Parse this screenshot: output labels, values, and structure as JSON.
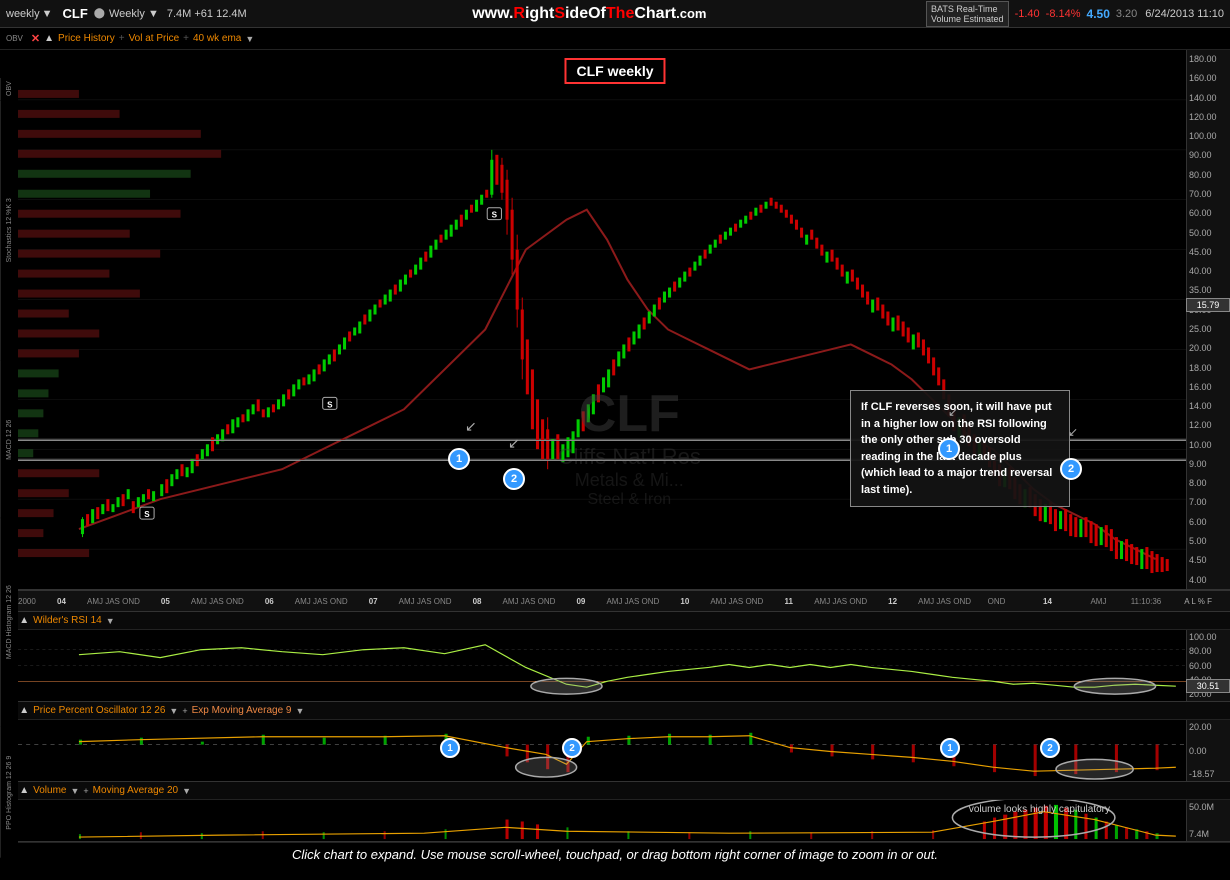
{
  "topbar": {
    "weekly_label": "weekly",
    "ticker": "CLF",
    "timeframe": "Weekly",
    "volume": "7.4M",
    "change_pts": "+61",
    "change_max": "12.4M",
    "website": "www.RightSideOfTheChart.com",
    "bats_label": "BATS Real-Time",
    "volume_est": "Volume Estimated",
    "price_change": "-1.40",
    "price_pct": "-8.14%",
    "price_val": "4.50",
    "price_low": "3.20",
    "datetime": "6/24/2013  11:10"
  },
  "indicators": {
    "price_history": "Price History",
    "vol_at_price": "Vol at Price",
    "ema_40": "40 wk ema"
  },
  "chart": {
    "title": "CLF weekly",
    "watermark": "CLF",
    "watermark_sub1": "Cliffs Nat'l Res",
    "watermark_sub2": "Metals & Mi...",
    "watermark_sub3": "Steel & Iron",
    "annotation": "If CLF reverses soon, it will have put in a higher low on the RSI following the only other sub 30 oversold reading in the last decade plus (which lead to a major trend reversal last time).",
    "current_price": "15.79",
    "price_levels": [
      "180.00",
      "160.00",
      "140.00",
      "120.00",
      "100.00",
      "90.00",
      "80.00",
      "70.00",
      "60.00",
      "50.00",
      "45.00",
      "40.00",
      "35.00",
      "30.00",
      "25.00",
      "20.00",
      "18.00",
      "16.00",
      "14.00",
      "12.00",
      "10.00",
      "9.00",
      "8.00",
      "7.00",
      "6.00",
      "5.00",
      "4.50",
      "4.00"
    ]
  },
  "timeline": {
    "items": [
      "04",
      "AMJ JAS OND",
      "05",
      "AMJ JAS OND",
      "06",
      "AMJ JAS OND",
      "07",
      "AMJ JAS OND",
      "08",
      "AMJ JAS OND",
      "09",
      "AMJ JAS OND",
      "10",
      "AMJ JAS OND",
      "11",
      "AMJ JAS OND",
      "12",
      "AMJ JAS OND",
      "OND",
      "14",
      "AMJ"
    ]
  },
  "rsi": {
    "title": "Wilder's RSI 14",
    "levels": [
      "100.00",
      "80.00",
      "60.00",
      "40.00",
      "20.00"
    ],
    "current": "30.51"
  },
  "ppo": {
    "title": "Price Percent Oscillator 12 26",
    "ema_label": "Exp Moving Average 9",
    "levels": [
      "20.00",
      "0.00",
      "-18.57"
    ]
  },
  "volume": {
    "title": "Volume",
    "ma_label": "Moving Average 20",
    "levels": [
      "50.0M",
      "7.4M"
    ],
    "note": "volume looks highly capitulatory"
  },
  "bottom": {
    "caption": "Click chart to expand. Use mouse scroll-wheel, touchpad, or drag bottom right corner of image to zoom in or out."
  },
  "sidebar_labels": [
    "OBV",
    "Stochastics 12 %K 3",
    "MACD 12 26",
    "MACD Histogram 12 26",
    "PPO Histogram 12 26 9"
  ]
}
